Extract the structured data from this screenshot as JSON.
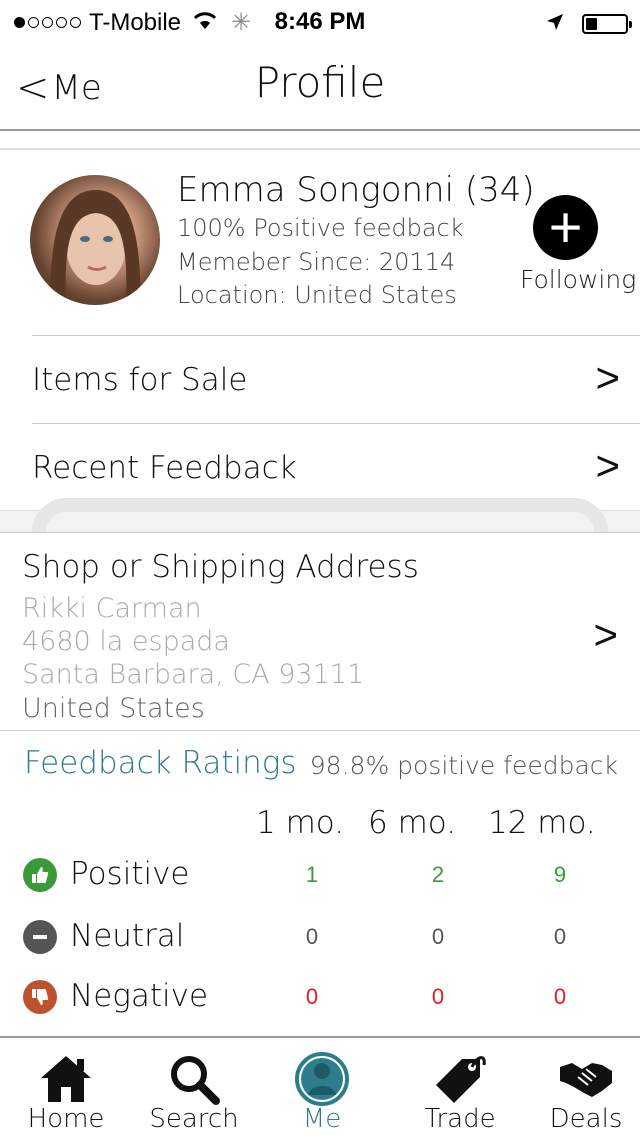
{
  "status_bar": {
    "carrier": "T-Mobile",
    "time": "8:46 PM",
    "signal_bars_filled": 1,
    "signal_bars_total": 5,
    "battery_level": 0.3
  },
  "nav": {
    "back_label": "Me",
    "title": "Profile"
  },
  "profile": {
    "name": "Emma Songonni (34)",
    "feedback": "100% Positive feedback",
    "member_since": "Memeber Since: 20114",
    "location": "Location: United States",
    "follow_label": "Following"
  },
  "menu": {
    "items_for_sale": "Items for Sale",
    "recent_feedback": "Recent Feedback"
  },
  "address": {
    "heading": "Shop or Shipping Address",
    "name": "Rikki Carman",
    "street": "4680 la espada",
    "city": "Santa Barbara, CA 93111",
    "country": "United States"
  },
  "ratings": {
    "title": "Feedback Ratings",
    "summary": "98.8% positive feedback",
    "columns": [
      "1 mo.",
      "6 mo.",
      "12 mo."
    ],
    "rows": [
      {
        "label": "Positive",
        "values": [
          "1",
          "2",
          "9"
        ],
        "color": "#3a9a3a",
        "icon": "thumbs-up-icon"
      },
      {
        "label": "Neutral",
        "values": [
          "0",
          "0",
          "0"
        ],
        "color": "#555555",
        "icon": "minus-icon"
      },
      {
        "label": "Negative",
        "values": [
          "0",
          "0",
          "0"
        ],
        "color": "#e02020",
        "icon": "thumbs-down-icon"
      }
    ]
  },
  "tabs": [
    {
      "label": "Home",
      "icon": "home-icon"
    },
    {
      "label": "Search",
      "icon": "search-icon"
    },
    {
      "label": "Me",
      "icon": "user-icon",
      "active": true
    },
    {
      "label": "Trade",
      "icon": "tag-icon"
    },
    {
      "label": "Deals",
      "icon": "handshake-icon"
    }
  ],
  "colors": {
    "accent": "#2e7d8c",
    "positive": "#3a9a3a",
    "negative": "#e02020"
  }
}
